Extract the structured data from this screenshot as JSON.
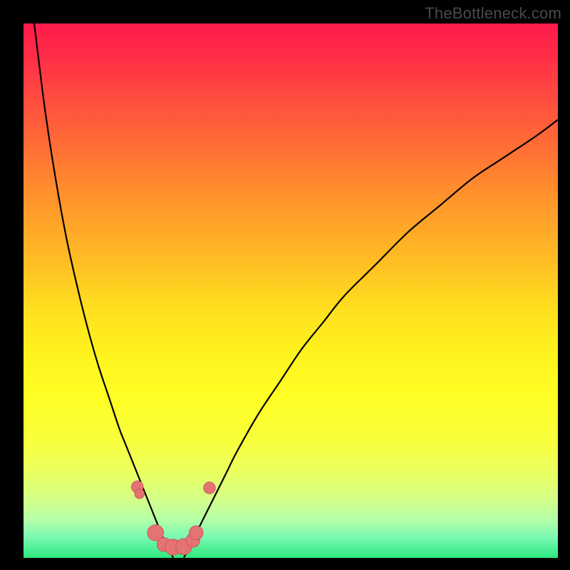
{
  "watermark": "TheBottleneck.com",
  "palette": {
    "background": "#000000",
    "curve_stroke": "#000000",
    "marker_fill": "#e57373",
    "marker_stroke": "#c85a5a"
  },
  "chart_data": {
    "type": "line",
    "title": "",
    "xlabel": "",
    "ylabel": "",
    "xlim": [
      0,
      100
    ],
    "ylim": [
      0,
      100
    ],
    "grid": false,
    "series": [
      {
        "name": "left-curve",
        "x": [
          2,
          4,
          6,
          8,
          10,
          12,
          14,
          16,
          18,
          19,
          20,
          21,
          22,
          23,
          24,
          25,
          26,
          27,
          28
        ],
        "values": [
          100,
          84,
          71,
          60,
          51,
          43,
          36,
          30,
          24,
          21.5,
          19,
          16.5,
          14,
          11.5,
          9,
          6.5,
          4,
          2,
          0
        ]
      },
      {
        "name": "right-curve",
        "x": [
          30,
          31,
          32,
          34,
          36,
          38,
          40,
          44,
          48,
          52,
          56,
          60,
          66,
          72,
          78,
          84,
          90,
          96,
          100
        ],
        "values": [
          0,
          2,
          4,
          8,
          12,
          16,
          20,
          27,
          33,
          39,
          44,
          49,
          55,
          61,
          66,
          71,
          75,
          79,
          82
        ]
      }
    ],
    "markers": [
      {
        "x": 21.3,
        "y": 13.3,
        "r": 1.1
      },
      {
        "x": 21.7,
        "y": 12.0,
        "r": 0.9
      },
      {
        "x": 24.7,
        "y": 4.7,
        "r": 1.5
      },
      {
        "x": 26.3,
        "y": 2.5,
        "r": 1.3
      },
      {
        "x": 28.0,
        "y": 2.0,
        "r": 1.5
      },
      {
        "x": 30.0,
        "y": 2.1,
        "r": 1.5
      },
      {
        "x": 31.7,
        "y": 3.3,
        "r": 1.3
      },
      {
        "x": 32.3,
        "y": 4.7,
        "r": 1.3
      },
      {
        "x": 34.8,
        "y": 13.1,
        "r": 1.1
      }
    ]
  }
}
